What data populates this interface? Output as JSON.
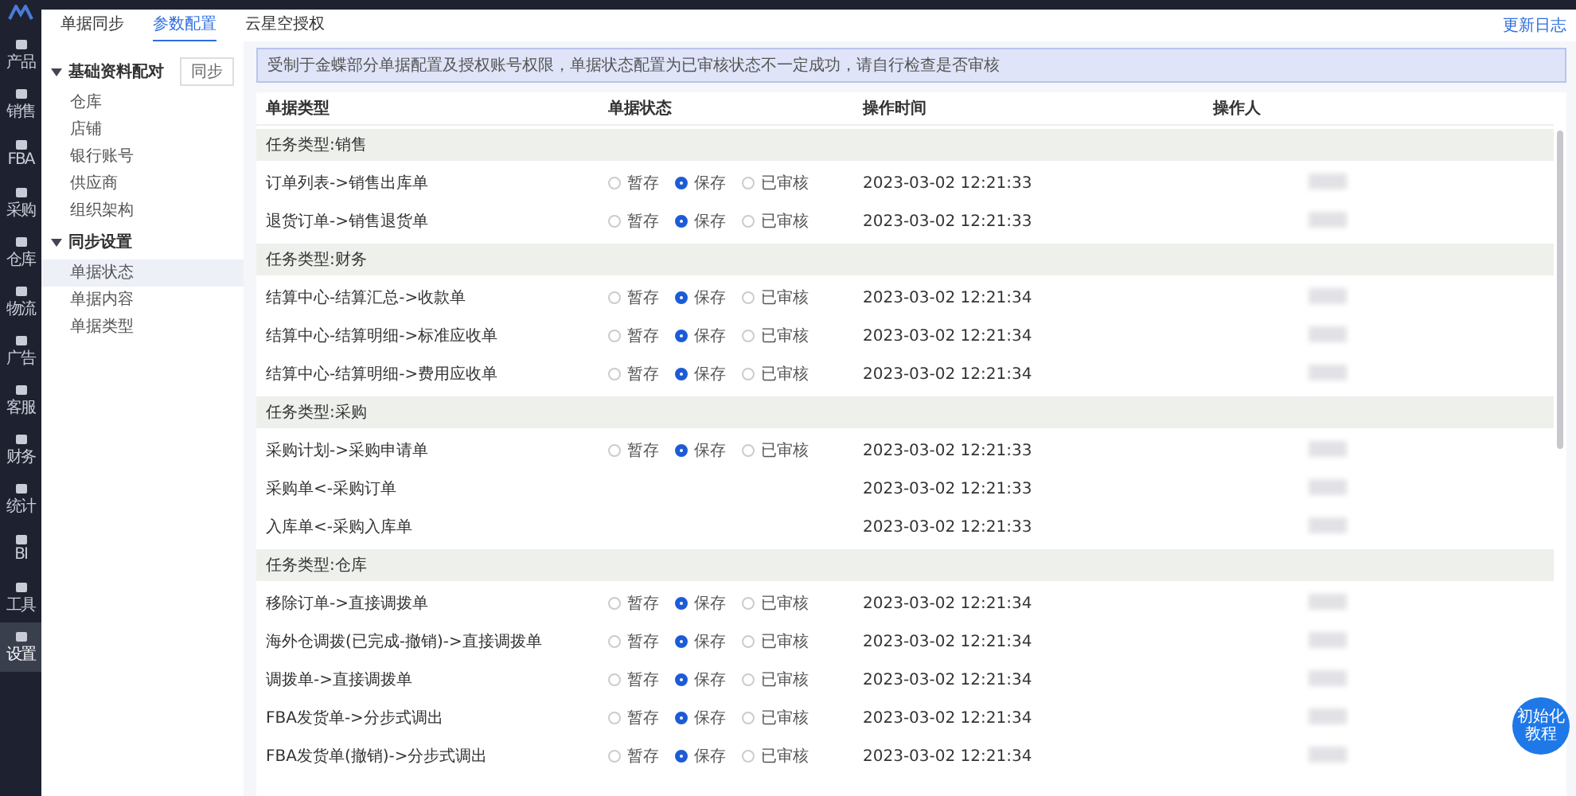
{
  "nav": [
    {
      "label": "产品",
      "selected": false
    },
    {
      "label": "销售",
      "selected": false
    },
    {
      "label": "FBA",
      "selected": false
    },
    {
      "label": "采购",
      "selected": false
    },
    {
      "label": "仓库",
      "selected": false
    },
    {
      "label": "物流",
      "selected": false
    },
    {
      "label": "广告",
      "selected": false
    },
    {
      "label": "客服",
      "selected": false
    },
    {
      "label": "财务",
      "selected": false
    },
    {
      "label": "统计",
      "selected": false
    },
    {
      "label": "BI",
      "selected": false
    },
    {
      "label": "工具",
      "selected": false
    },
    {
      "label": "设置",
      "selected": true
    }
  ],
  "tabs": [
    {
      "label": "单据同步",
      "selected": false
    },
    {
      "label": "参数配置",
      "selected": true
    },
    {
      "label": "云星空授权",
      "selected": false
    }
  ],
  "changelog_link": "更新日志",
  "sidebar": [
    {
      "label": "基础资料配对",
      "expanded": true,
      "button": "同步",
      "children": [
        {
          "label": "仓库",
          "selected": false
        },
        {
          "label": "店铺",
          "selected": false
        },
        {
          "label": "银行账号",
          "selected": false
        },
        {
          "label": "供应商",
          "selected": false
        },
        {
          "label": "组织架构",
          "selected": false
        }
      ]
    },
    {
      "label": "同步设置",
      "expanded": true,
      "children": [
        {
          "label": "单据状态",
          "selected": true
        },
        {
          "label": "单据内容",
          "selected": false
        },
        {
          "label": "单据类型",
          "selected": false
        }
      ]
    }
  ],
  "alert": "受制于金蝶部分单据配置及授权账号权限，单据状态配置为已审核状态不一定成功，请自行检查是否审核",
  "table": {
    "columns": [
      "单据类型",
      "单据状态",
      "操作时间",
      "操作人"
    ],
    "rows": [
      {
        "kind": "group",
        "label": "任务类型:销售"
      },
      {
        "kind": "item",
        "label": "订单列表->销售出库单",
        "options": [
          {
            "label": "暂存",
            "selected": false
          },
          {
            "label": "保存",
            "selected": true
          },
          {
            "label": "已审核",
            "selected": false
          }
        ],
        "time": "2023-03-02 12:21:33"
      },
      {
        "kind": "item",
        "label": "退货订单->销售退货单",
        "options": [
          {
            "label": "暂存",
            "selected": false
          },
          {
            "label": "保存",
            "selected": true
          },
          {
            "label": "已审核",
            "selected": false
          }
        ],
        "time": "2023-03-02 12:21:33"
      },
      {
        "kind": "group",
        "label": "任务类型:财务"
      },
      {
        "kind": "item",
        "label": "结算中心-结算汇总->收款单",
        "options": [
          {
            "label": "暂存",
            "selected": false
          },
          {
            "label": "保存",
            "selected": true
          },
          {
            "label": "已审核",
            "selected": false
          }
        ],
        "time": "2023-03-02 12:21:34"
      },
      {
        "kind": "item",
        "label": "结算中心-结算明细->标准应收单",
        "options": [
          {
            "label": "暂存",
            "selected": false
          },
          {
            "label": "保存",
            "selected": true
          },
          {
            "label": "已审核",
            "selected": false
          }
        ],
        "time": "2023-03-02 12:21:34"
      },
      {
        "kind": "item",
        "label": "结算中心-结算明细->费用应收单",
        "options": [
          {
            "label": "暂存",
            "selected": false
          },
          {
            "label": "保存",
            "selected": true
          },
          {
            "label": "已审核",
            "selected": false
          }
        ],
        "time": "2023-03-02 12:21:34"
      },
      {
        "kind": "group",
        "label": "任务类型:采购"
      },
      {
        "kind": "item",
        "label": "采购计划->采购申请单",
        "options": [
          {
            "label": "暂存",
            "selected": false
          },
          {
            "label": "保存",
            "selected": true
          },
          {
            "label": "已审核",
            "selected": false
          }
        ],
        "time": "2023-03-02 12:21:33"
      },
      {
        "kind": "item",
        "label": "采购单<-采购订单",
        "time": "2023-03-02 12:21:33"
      },
      {
        "kind": "item",
        "label": "入库单<-采购入库单",
        "time": "2023-03-02 12:21:33"
      },
      {
        "kind": "group",
        "label": "任务类型:仓库"
      },
      {
        "kind": "item",
        "label": "移除订单->直接调拨单",
        "options": [
          {
            "label": "暂存",
            "selected": false
          },
          {
            "label": "保存",
            "selected": true
          },
          {
            "label": "已审核",
            "selected": false
          }
        ],
        "time": "2023-03-02 12:21:34"
      },
      {
        "kind": "item",
        "label": "海外仓调拨(已完成-撤销)->直接调拨单",
        "options": [
          {
            "label": "暂存",
            "selected": false
          },
          {
            "label": "保存",
            "selected": true
          },
          {
            "label": "已审核",
            "selected": false
          }
        ],
        "time": "2023-03-02 12:21:34"
      },
      {
        "kind": "item",
        "label": "调拨单->直接调拨单",
        "options": [
          {
            "label": "暂存",
            "selected": false
          },
          {
            "label": "保存",
            "selected": true
          },
          {
            "label": "已审核",
            "selected": false
          }
        ],
        "time": "2023-03-02 12:21:34"
      },
      {
        "kind": "item",
        "label": "FBA发货单->分步式调出",
        "options": [
          {
            "label": "暂存",
            "selected": false
          },
          {
            "label": "保存",
            "selected": true
          },
          {
            "label": "已审核",
            "selected": false
          }
        ],
        "time": "2023-03-02 12:21:34"
      },
      {
        "kind": "item",
        "label": "FBA发货单(撤销)->分步式调出",
        "options": [
          {
            "label": "暂存",
            "selected": false
          },
          {
            "label": "保存",
            "selected": true
          },
          {
            "label": "已审核",
            "selected": false
          }
        ],
        "time": "2023-03-02 12:21:34"
      }
    ]
  },
  "help_button": "初始化教程"
}
